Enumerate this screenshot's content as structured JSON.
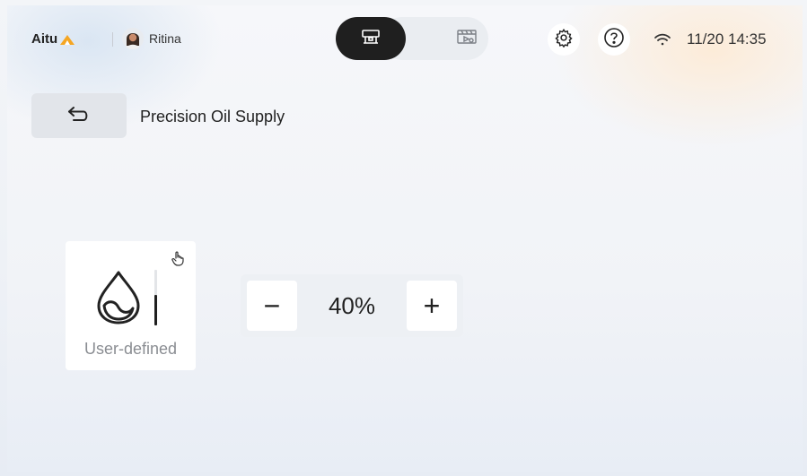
{
  "header": {
    "logo_text": "Aitu",
    "logo_icon": "aitu-logo-mark",
    "user_name": "Ritina",
    "modes": [
      {
        "icon": "machine-icon",
        "active": true
      },
      {
        "icon": "video-monitor-icon",
        "active": false
      }
    ],
    "settings_icon": "gear-icon",
    "help_icon": "help-icon",
    "wifi_icon": "wifi-icon",
    "datetime": "11/20 14:35"
  },
  "page": {
    "back_icon": "back-arrow-icon",
    "title": "Precision Oil Supply"
  },
  "oil_mode_card": {
    "label": "User-defined",
    "icon": "oil-drop-icon",
    "touch_icon": "hand-touch-icon",
    "level_fraction": 0.55
  },
  "oil_stepper": {
    "value": "40%",
    "minus_label": "−",
    "plus_label": "+"
  },
  "colors": {
    "accent": "#f5a623",
    "dark": "#1f1f1f",
    "muted_text": "#8a8d92"
  }
}
